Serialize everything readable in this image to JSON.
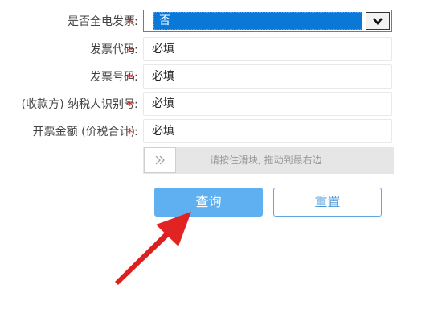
{
  "form": {
    "required_mark": "*",
    "colon": ":",
    "full_invoice": {
      "label": "是否全电发票",
      "selected": "否"
    },
    "invoice_code": {
      "label": "发票代码",
      "value": "必填"
    },
    "invoice_number": {
      "label": "发票号码",
      "value": "必填"
    },
    "taxpayer_id": {
      "label": "(收款方) 纳税人识别号",
      "value": "必填"
    },
    "amount": {
      "label": "开票金额 (价税合计)",
      "value": "必填"
    }
  },
  "slider": {
    "handle_glyph": "»",
    "hint": "请按住滑块, 拖动到最右边"
  },
  "buttons": {
    "query": "查询",
    "reset": "重置"
  },
  "annotation": {
    "arrow_color": "#e02020"
  }
}
